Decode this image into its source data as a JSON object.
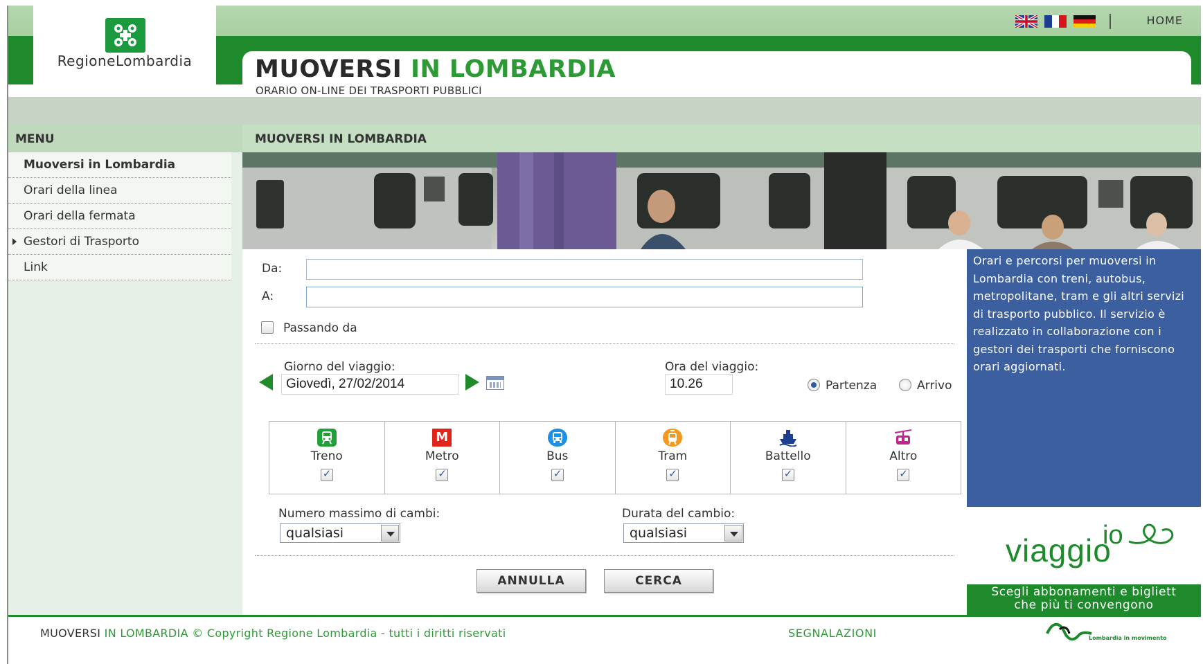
{
  "header": {
    "logo_text": "RegioneLombardia",
    "title_part1": "MUOVERSI ",
    "title_part2": "IN LOMBARDIA",
    "subtitle": "ORARIO ON-LINE DEI TRASPORTI PUBBLICI",
    "languages": [
      "en-flag-icon",
      "fr-flag-icon",
      "de-flag-icon"
    ],
    "home_label": "HOME"
  },
  "sidebar": {
    "title": "MENU",
    "items": [
      {
        "label": "Muoversi in Lombardia",
        "active": true
      },
      {
        "label": "Orari della linea"
      },
      {
        "label": "Orari della fermata"
      },
      {
        "label": "Gestori di Trasporto",
        "has_submenu": true
      },
      {
        "label": "Link"
      }
    ]
  },
  "main": {
    "section_title": "MUOVERSI IN LOMBARDIA"
  },
  "form": {
    "from_label": "Da:",
    "from_value": "",
    "to_label": "A:",
    "to_value": "",
    "via_label": "Passando da",
    "via_checked": false,
    "date_label": "Giorno del viaggio:",
    "date_value": "Giovedì, 27/02/2014",
    "time_label": "Ora del viaggio:",
    "time_value": "10.26",
    "departure_label": "Partenza",
    "arrival_label": "Arrivo",
    "time_mode": "Partenza",
    "modes": [
      {
        "label": "Treno",
        "icon": "train-icon",
        "color": "#21a03a",
        "glyph": "",
        "checked": true
      },
      {
        "label": "Metro",
        "icon": "metro-icon",
        "color": "#e2231a",
        "glyph": "M",
        "checked": true
      },
      {
        "label": "Bus",
        "icon": "bus-icon",
        "color": "#1e90e0",
        "glyph": "",
        "checked": true
      },
      {
        "label": "Tram",
        "icon": "tram-icon",
        "color": "#f29a1f",
        "glyph": "",
        "checked": true
      },
      {
        "label": "Battello",
        "icon": "boat-icon",
        "color": "#1d3f91",
        "glyph": "",
        "checked": true
      },
      {
        "label": "Altro",
        "icon": "cable-car-icon",
        "color": "#c0248e",
        "glyph": "",
        "checked": true
      }
    ],
    "max_changes_label": "Numero massimo di cambi:",
    "max_changes_value": "qualsiasi",
    "change_duration_label": "Durata del cambio:",
    "change_duration_value": "qualsiasi",
    "cancel_label": "ANNULLA",
    "search_label": "CERCA"
  },
  "info": {
    "text": "Orari e percorsi per muoversi in Lombardia con treni, autobus, metropolitane, tram e gli altri servizi di trasporto pubblico. Il servizio è realizzato in collaborazione con i gestori dei trasporti che forniscono orari aggiornati."
  },
  "promo": {
    "logo_io": "io",
    "logo_viaggio": "viaggio",
    "tagline_line1": "Scegli abbonamenti e bigliett",
    "tagline_line2": "che più ti convengono"
  },
  "footer": {
    "brand_part1": "MUOVERSI ",
    "brand_part2": "IN LOMBARDIA",
    "copyright": " © Copyright Regione Lombardia - tutti i diritti riservati",
    "report_label": "SEGNALAZIONI",
    "logo_text": "Lombardia in movimento"
  },
  "colors": {
    "brand_green": "#1e8a2b",
    "info_blue": "#3c5fa0"
  }
}
